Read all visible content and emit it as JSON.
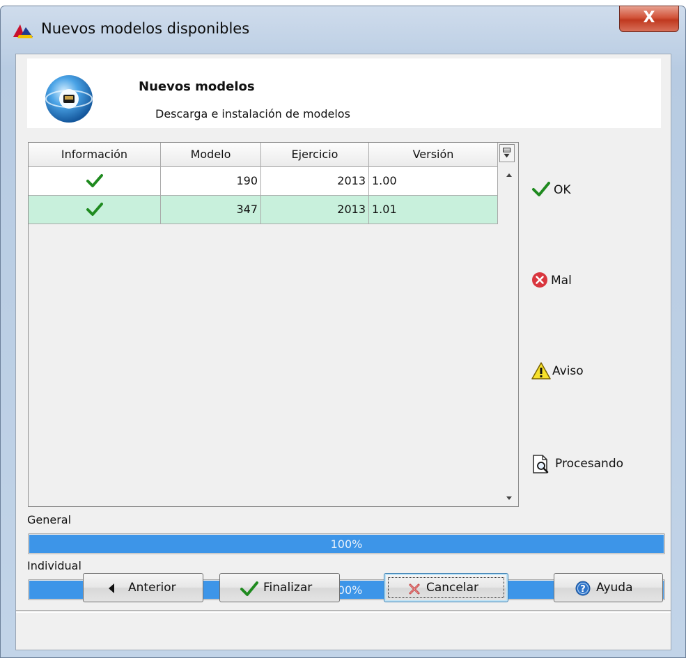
{
  "window": {
    "title": "Nuevos modelos disponibles",
    "close_label": "X"
  },
  "header": {
    "title": "Nuevos modelos",
    "subtitle": "Descarga e instalación de modelos"
  },
  "table": {
    "columns": [
      "Información",
      "Modelo",
      "Ejercicio",
      "Versión"
    ],
    "rows": [
      {
        "status_icon": "check-icon",
        "modelo": "190",
        "ejercicio": "2013",
        "version": "1.00"
      },
      {
        "status_icon": "check-icon",
        "modelo": "347",
        "ejercicio": "2013",
        "version": "1.01"
      }
    ]
  },
  "legend": {
    "ok": "OK",
    "mal": "Mal",
    "aviso": "Aviso",
    "procesando": "Procesando"
  },
  "progress": {
    "general_label": "General",
    "general_text": "100%",
    "general_value": 1.0,
    "individual_label": "Individual",
    "individual_text": "100%",
    "individual_value": 1.0
  },
  "buttons": {
    "anterior": "Anterior",
    "finalizar": "Finalizar",
    "cancelar": "Cancelar",
    "ayuda": "Ayuda"
  },
  "colors": {
    "selected_row": "#c8f0dc",
    "progress_fill": "#3d95e8",
    "check_green": "#1f8a1f"
  }
}
